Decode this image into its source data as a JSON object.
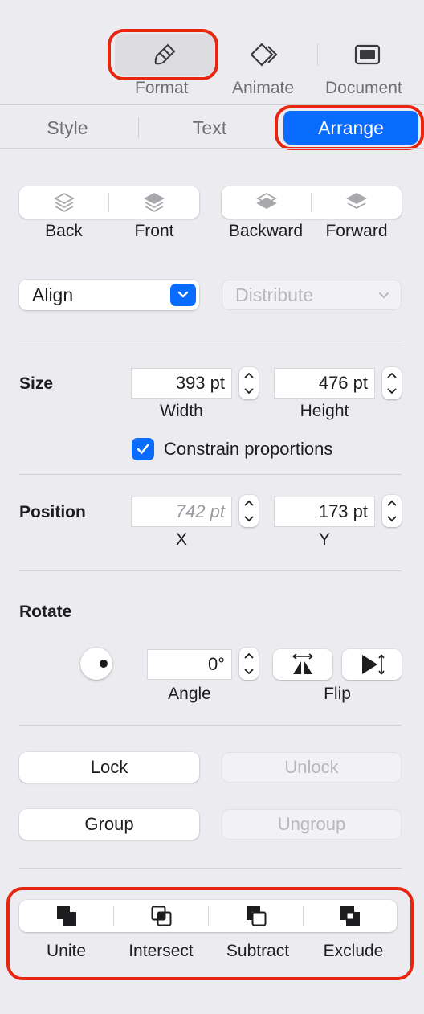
{
  "toolbar": {
    "format": "Format",
    "animate": "Animate",
    "document": "Document"
  },
  "tabs": {
    "style": "Style",
    "text": "Text",
    "arrange": "Arrange"
  },
  "layer": {
    "back": "Back",
    "front": "Front",
    "backward": "Backward",
    "forward": "Forward"
  },
  "align": {
    "align_label": "Align",
    "distribute_label": "Distribute"
  },
  "size": {
    "title": "Size",
    "width_value": "393 pt",
    "height_value": "476 pt",
    "width_label": "Width",
    "height_label": "Height",
    "constrain_label": "Constrain proportions",
    "constrain_checked": true
  },
  "position": {
    "title": "Position",
    "x_placeholder": "742 pt",
    "y_value": "173 pt",
    "x_label": "X",
    "y_label": "Y"
  },
  "rotate": {
    "title": "Rotate",
    "angle_value": "0°",
    "angle_label": "Angle",
    "flip_label": "Flip"
  },
  "lock": {
    "lock": "Lock",
    "unlock": "Unlock",
    "group": "Group",
    "ungroup": "Ungroup"
  },
  "boolean": {
    "unite": "Unite",
    "intersect": "Intersect",
    "subtract": "Subtract",
    "exclude": "Exclude"
  },
  "colors": {
    "accent": "#0a6cff",
    "highlight_ring": "#e8260f",
    "panel_bg": "#ececf0"
  }
}
